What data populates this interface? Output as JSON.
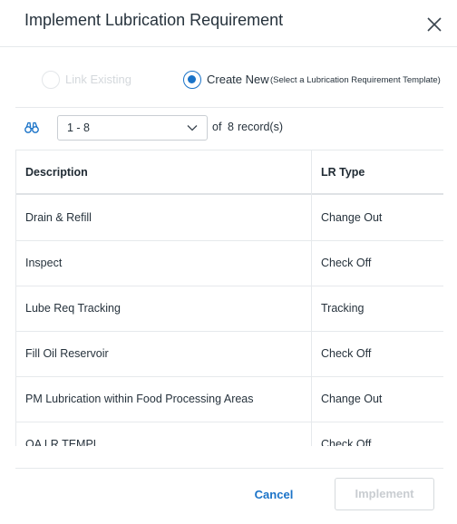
{
  "dialog": {
    "title": "Implement Lubrication Requirement"
  },
  "mode": {
    "link_existing_label": "Link Existing",
    "link_existing_selected": false,
    "link_existing_disabled": true,
    "create_new_label": "Create New",
    "create_new_selected": true,
    "create_new_hint": "(Select a Lubrication Requirement Template)"
  },
  "toolbar": {
    "find_icon": "binoculars-icon",
    "range_value": "1 - 8",
    "of_label": "of",
    "record_count": "8",
    "records_label": "record(s)"
  },
  "grid": {
    "columns": {
      "description": "Description",
      "lr_type": "LR Type"
    },
    "rows": [
      {
        "description": "Drain & Refill",
        "lr_type": "Change Out"
      },
      {
        "description": "Inspect",
        "lr_type": "Check Off"
      },
      {
        "description": "Lube Req Tracking",
        "lr_type": "Tracking"
      },
      {
        "description": "Fill Oil Reservoir",
        "lr_type": "Check Off"
      },
      {
        "description": "PM Lubrication within Food Processing Areas",
        "lr_type": "Change Out"
      },
      {
        "description": "OA LR TEMPL",
        "lr_type": "Check Off"
      }
    ]
  },
  "footer": {
    "cancel_label": "Cancel",
    "implement_label": "Implement",
    "implement_disabled": true
  },
  "colors": {
    "accent": "#1a73c8",
    "disabled_text": "#c9cdd1",
    "border": "#e6e9ec"
  }
}
